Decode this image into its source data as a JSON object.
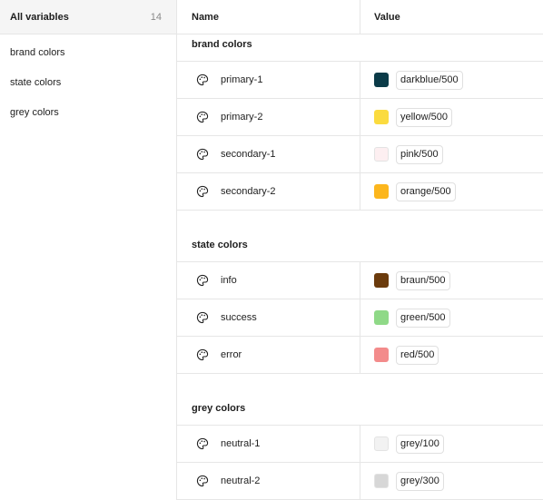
{
  "sidebar": {
    "all_label": "All variables",
    "all_count": "14",
    "items": [
      {
        "label": "brand colors"
      },
      {
        "label": "state colors"
      },
      {
        "label": "grey colors"
      }
    ]
  },
  "table": {
    "col_name": "Name",
    "col_value": "Value"
  },
  "groups": [
    {
      "title": "brand colors",
      "rows": [
        {
          "name": "primary-1",
          "value": "darkblue/500",
          "color": "#0b3b48"
        },
        {
          "name": "primary-2",
          "value": "yellow/500",
          "color": "#fbdb3f"
        },
        {
          "name": "secondary-1",
          "value": "pink/500",
          "color": "#fdeff1"
        },
        {
          "name": "secondary-2",
          "value": "orange/500",
          "color": "#fcb61d"
        }
      ]
    },
    {
      "title": "state colors",
      "rows": [
        {
          "name": "info",
          "value": "braun/500",
          "color": "#6b3b0c"
        },
        {
          "name": "success",
          "value": "green/500",
          "color": "#8fd987"
        },
        {
          "name": "error",
          "value": "red/500",
          "color": "#f38b8b"
        }
      ]
    },
    {
      "title": "grey colors",
      "rows": [
        {
          "name": "neutral-1",
          "value": "grey/100",
          "color": "#f2f2f2"
        },
        {
          "name": "neutral-2",
          "value": "grey/300",
          "color": "#d7d7d7"
        }
      ]
    }
  ]
}
